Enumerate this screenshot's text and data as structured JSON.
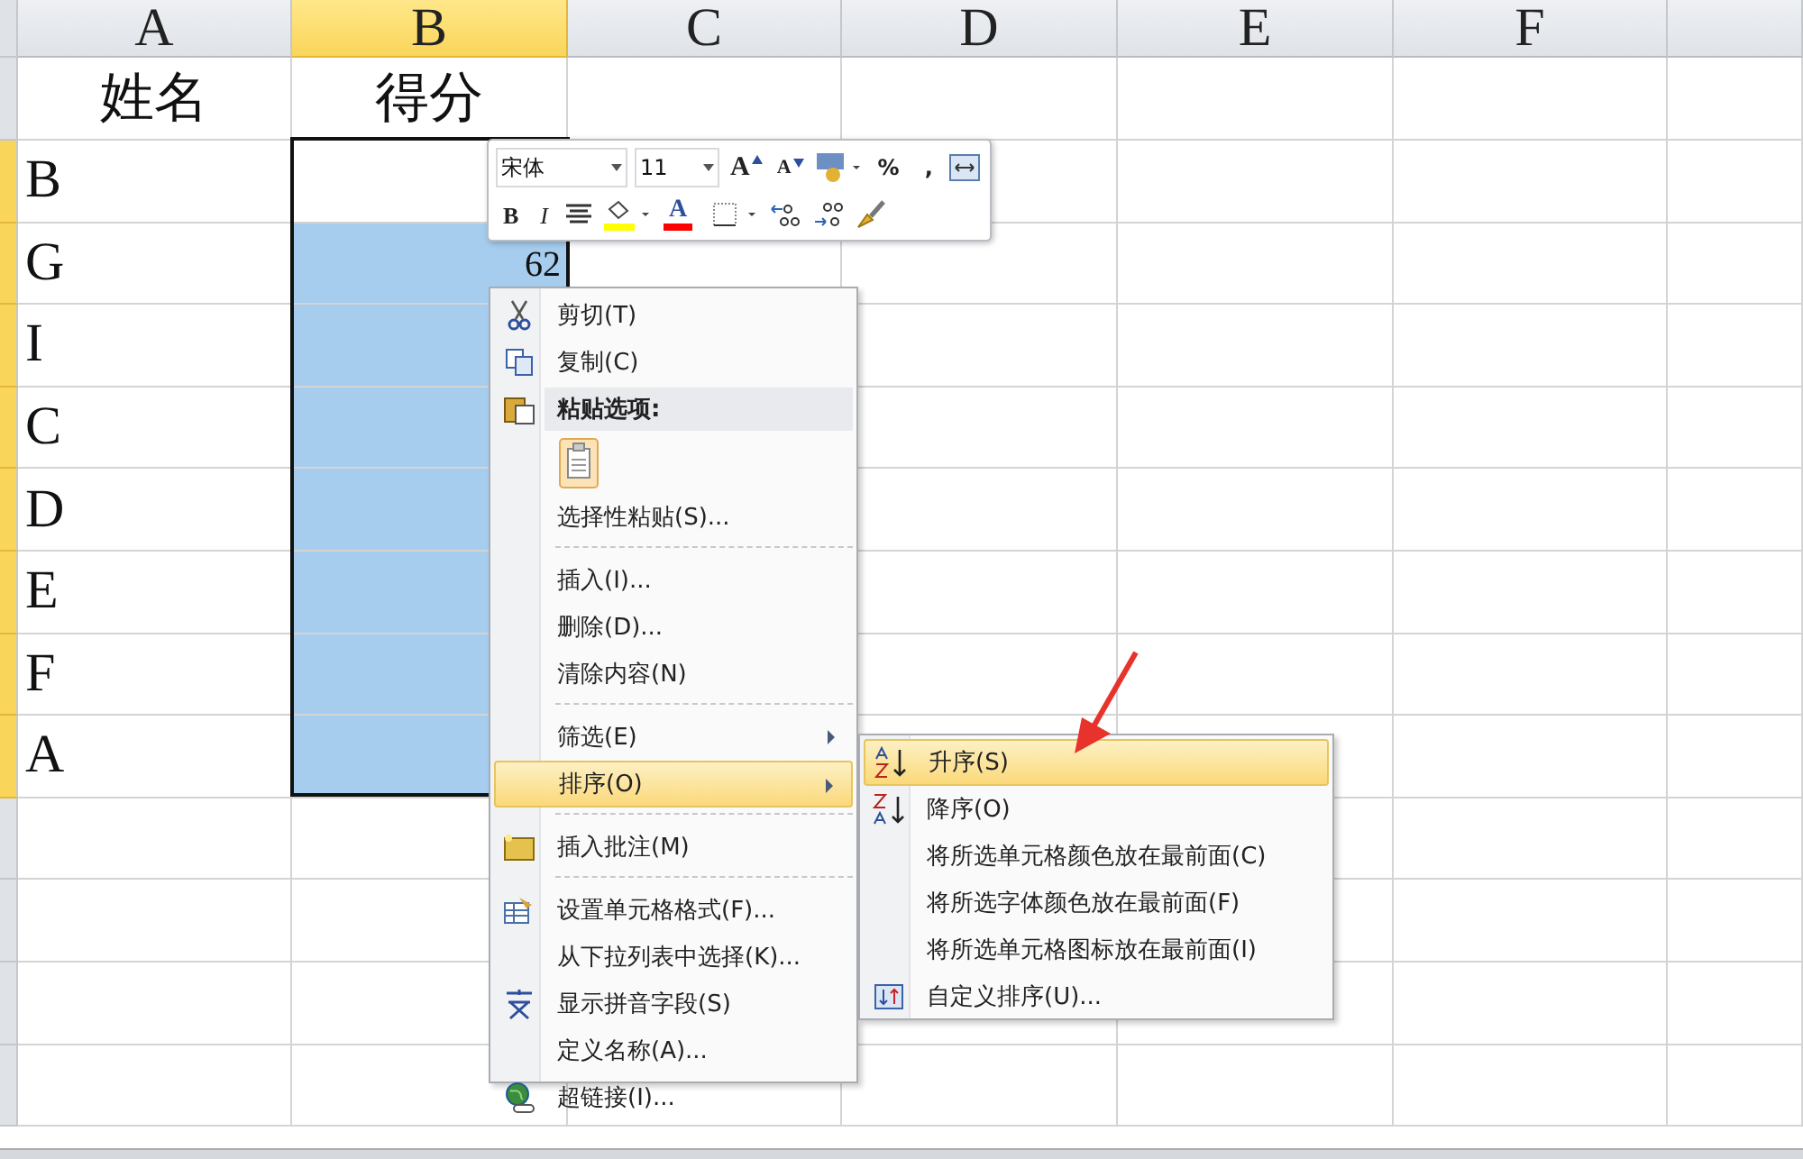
{
  "sheet": {
    "columns": [
      {
        "label": "A",
        "selected": false
      },
      {
        "label": "B",
        "selected": true
      },
      {
        "label": "C",
        "selected": false
      },
      {
        "label": "D",
        "selected": false
      },
      {
        "label": "E",
        "selected": false
      },
      {
        "label": "F",
        "selected": false
      }
    ],
    "rows": [
      {
        "selected": false,
        "cells": [
          {
            "text": "姓名",
            "highlighted": false
          },
          {
            "text": "得分",
            "highlighted": false
          }
        ]
      },
      {
        "selected": true,
        "cells": [
          {
            "text": "B",
            "highlighted": false
          },
          {
            "text": "",
            "highlighted": false
          }
        ]
      },
      {
        "selected": true,
        "cells": [
          {
            "text": "G",
            "highlighted": false
          },
          {
            "text": "62",
            "highlighted": true
          }
        ]
      },
      {
        "selected": true,
        "cells": [
          {
            "text": "I",
            "highlighted": false
          },
          {
            "text": "",
            "highlighted": true
          }
        ]
      },
      {
        "selected": true,
        "cells": [
          {
            "text": "C",
            "highlighted": false
          },
          {
            "text": "",
            "highlighted": true
          }
        ]
      },
      {
        "selected": true,
        "cells": [
          {
            "text": "D",
            "highlighted": false
          },
          {
            "text": "",
            "highlighted": true
          }
        ]
      },
      {
        "selected": true,
        "cells": [
          {
            "text": "E",
            "highlighted": false
          },
          {
            "text": "",
            "highlighted": true
          }
        ]
      },
      {
        "selected": true,
        "cells": [
          {
            "text": "F",
            "highlighted": false
          },
          {
            "text": "",
            "highlighted": true
          }
        ]
      },
      {
        "selected": true,
        "cells": [
          {
            "text": "A",
            "highlighted": false
          },
          {
            "text": "",
            "highlighted": true
          }
        ]
      }
    ]
  },
  "mini_toolbar": {
    "font": "宋体",
    "size": "11",
    "row_1": [
      {
        "kind": "grow",
        "label": "A"
      },
      {
        "kind": "shrink",
        "label": "A"
      },
      {
        "kind": "currency"
      },
      {
        "kind": "text",
        "label": "%"
      },
      {
        "kind": "text",
        "label": ","
      },
      {
        "kind": "merge"
      }
    ],
    "row_2": [
      {
        "kind": "bold",
        "label": "B"
      },
      {
        "kind": "italic",
        "label": "I"
      },
      {
        "kind": "center"
      },
      {
        "kind": "fill",
        "color": "#ffff00"
      },
      {
        "kind": "fontcolor",
        "label": "A",
        "color": "#ff0000"
      },
      {
        "kind": "border"
      },
      {
        "kind": "inc"
      },
      {
        "kind": "dec"
      },
      {
        "kind": "brush"
      }
    ]
  },
  "context_menu": [
    {
      "kind": "item",
      "label": "剪切(T)",
      "submenu": false,
      "selected": false
    },
    {
      "kind": "item",
      "label": "复制(C)",
      "submenu": false,
      "selected": false
    },
    {
      "kind": "header",
      "label": "粘贴选项:"
    },
    {
      "kind": "paste"
    },
    {
      "kind": "item",
      "label": "选择性粘贴(S)...",
      "submenu": false,
      "selected": false
    },
    {
      "kind": "separator"
    },
    {
      "kind": "item",
      "label": "插入(I)...",
      "submenu": false,
      "selected": false
    },
    {
      "kind": "item",
      "label": "删除(D)...",
      "submenu": false,
      "selected": false
    },
    {
      "kind": "item",
      "label": "清除内容(N)",
      "submenu": false,
      "selected": false
    },
    {
      "kind": "separator"
    },
    {
      "kind": "item",
      "label": "筛选(E)",
      "submenu": true,
      "selected": false
    },
    {
      "kind": "item",
      "label": "排序(O)",
      "submenu": true,
      "selected": true
    },
    {
      "kind": "separator"
    },
    {
      "kind": "item",
      "label": "插入批注(M)",
      "submenu": false,
      "selected": false
    },
    {
      "kind": "separator"
    },
    {
      "kind": "item",
      "label": "设置单元格格式(F)...",
      "submenu": false,
      "selected": false
    },
    {
      "kind": "item",
      "label": "从下拉列表中选择(K)...",
      "submenu": false,
      "selected": false
    },
    {
      "kind": "item",
      "label": "显示拼音字段(S)",
      "submenu": false,
      "selected": false
    },
    {
      "kind": "item",
      "label": "定义名称(A)...",
      "submenu": false,
      "selected": false
    },
    {
      "kind": "item",
      "label": "超链接(I)...",
      "submenu": false,
      "selected": false
    }
  ],
  "sort_submenu": [
    {
      "label": "升序(S)",
      "selected": true
    },
    {
      "label": "降序(O)",
      "selected": false
    },
    {
      "label": "将所选单元格颜色放在最前面(C)",
      "selected": false
    },
    {
      "label": "将所选字体颜色放在最前面(F)",
      "selected": false
    },
    {
      "label": "将所选单元格图标放在最前面(I)",
      "selected": false
    },
    {
      "label": "自定义排序(U)...",
      "selected": false
    }
  ]
}
